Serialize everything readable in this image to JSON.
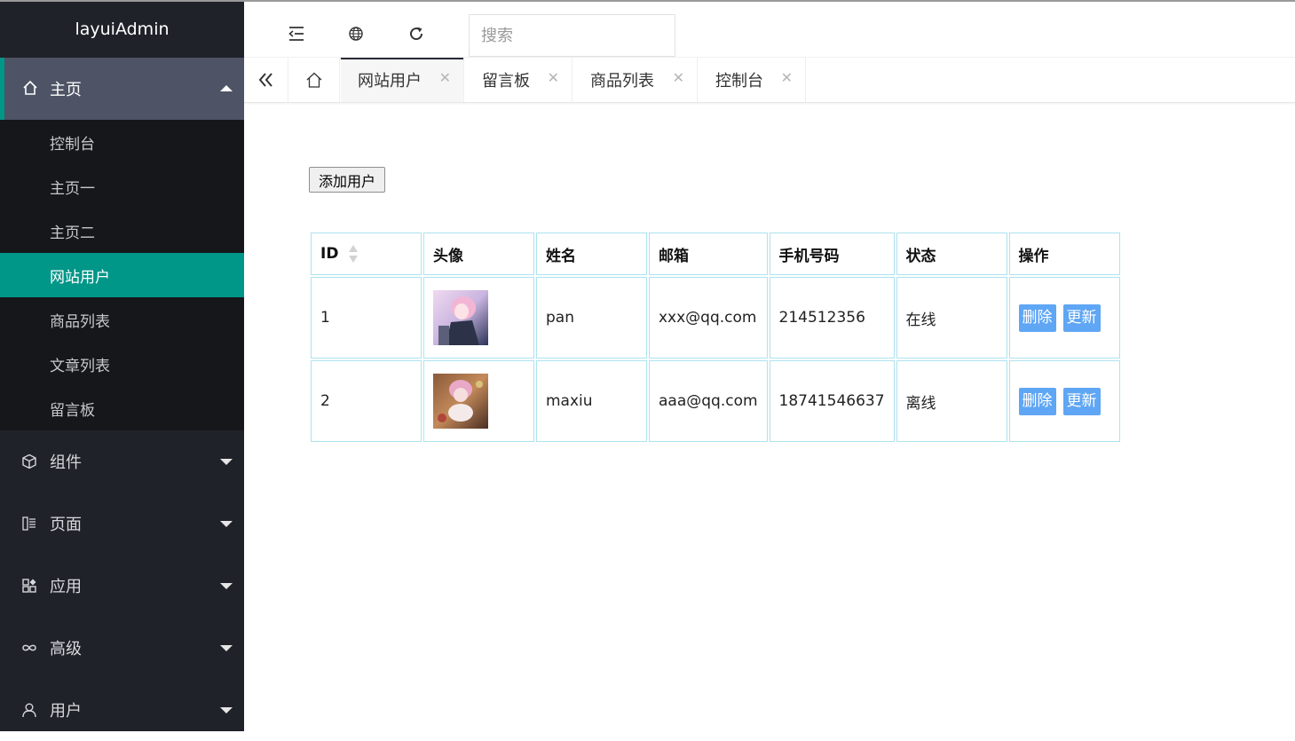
{
  "app": {
    "title": "layuiAdmin"
  },
  "sidebar": {
    "home_group": {
      "label": "主页",
      "items": [
        {
          "label": "控制台",
          "active": false
        },
        {
          "label": "主页一",
          "active": false
        },
        {
          "label": "主页二",
          "active": false
        },
        {
          "label": "网站用户",
          "active": true
        },
        {
          "label": "商品列表",
          "active": false
        },
        {
          "label": "文章列表",
          "active": false
        },
        {
          "label": "留言板",
          "active": false
        }
      ]
    },
    "groups": [
      {
        "label": "组件",
        "icon": "cube-icon"
      },
      {
        "label": "页面",
        "icon": "page-icon"
      },
      {
        "label": "应用",
        "icon": "apps-icon"
      },
      {
        "label": "高级",
        "icon": "infinity-icon"
      },
      {
        "label": "用户",
        "icon": "user-icon"
      }
    ]
  },
  "header": {
    "search": {
      "placeholder": "搜索",
      "value": ""
    }
  },
  "tabs": [
    {
      "label": "网站用户",
      "active": true
    },
    {
      "label": "留言板",
      "active": false
    },
    {
      "label": "商品列表",
      "active": false
    },
    {
      "label": "控制台",
      "active": false
    }
  ],
  "main": {
    "add_button": "添加用户",
    "table": {
      "headers": [
        "ID",
        "头像",
        "姓名",
        "邮箱",
        "手机号码",
        "状态",
        "操作"
      ],
      "rows": [
        {
          "id": "1",
          "name": "pan",
          "email": "xxx@qq.com",
          "phone": "214512356",
          "status": "在线",
          "delete": "删除",
          "update": "更新"
        },
        {
          "id": "2",
          "name": "maxiu",
          "email": "aaa@qq.com",
          "phone": "18741546637",
          "status": "离线",
          "delete": "删除",
          "update": "更新"
        }
      ]
    }
  },
  "colors": {
    "sidebar_bg": "#20222a",
    "accent": "#009688",
    "button_blue": "#5fa6f5",
    "table_border": "#ade3ef"
  }
}
